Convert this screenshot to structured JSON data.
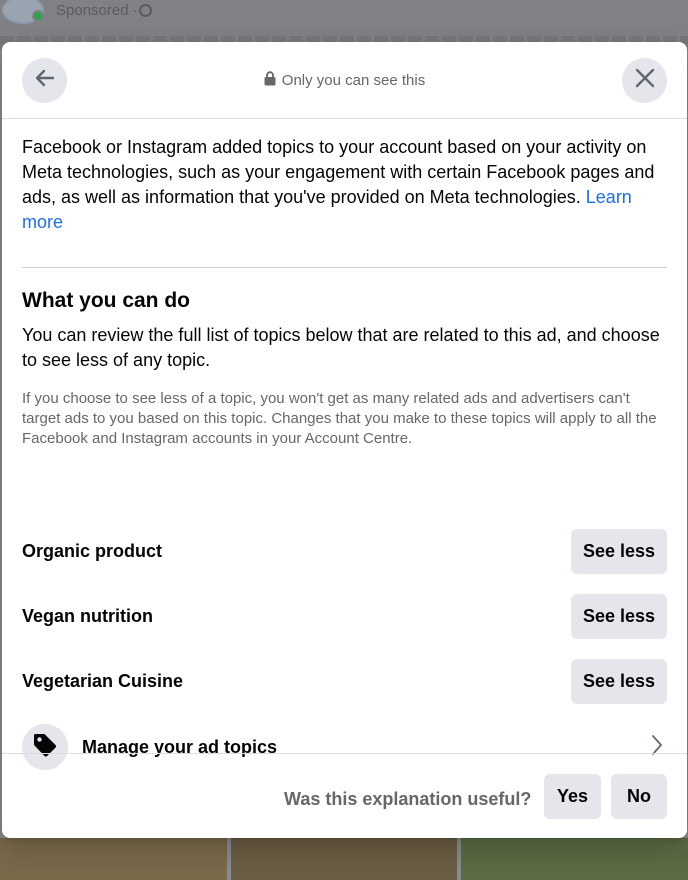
{
  "background": {
    "sponsored_label": "Sponsored ·"
  },
  "header": {
    "title": "Only you can see this",
    "back_icon": "arrow-left-icon",
    "close_icon": "close-icon",
    "lock_icon": "lock-icon"
  },
  "intro": {
    "text": "Facebook or Instagram added topics to your account based on your activity on Meta technologies, such as your engagement with certain Facebook pages and ads, as well as information that you've provided on Meta technologies.",
    "learn_more": "Learn more"
  },
  "section": {
    "title": "What you can do",
    "description": "You can review the full list of topics below that are related to this ad, and choose to see less of any topic.",
    "note": "If you choose to see less of a topic, you won't get as many related ads and advertisers can't target ads to you based on this topic. Changes that you make to these topics will apply to all the Facebook and Instagram accounts in your Account Centre."
  },
  "topics": [
    {
      "label": "Organic product",
      "button": "See less"
    },
    {
      "label": "Vegan nutrition",
      "button": "See less"
    },
    {
      "label": "Vegetarian Cuisine",
      "button": "See less"
    }
  ],
  "manage": {
    "label": "Manage your ad topics",
    "icon": "tag-icon",
    "chevron": "chevron-right-icon"
  },
  "footer": {
    "question": "Was this explanation useful?",
    "yes": "Yes",
    "no": "No"
  },
  "colors": {
    "link": "#216fdb",
    "button_bg": "#e4e6eb",
    "secondary_text": "#65676b"
  }
}
